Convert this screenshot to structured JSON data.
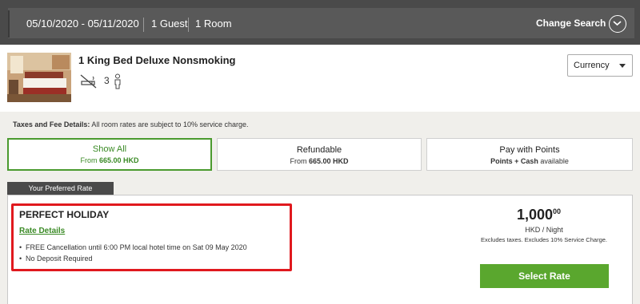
{
  "search": {
    "dates": "05/10/2020 - 05/11/2020",
    "guests": "1 Guest",
    "rooms": "1 Room",
    "change_label": "Change Search",
    "change_icon": "chevron-down-icon"
  },
  "room": {
    "title": "1 King Bed Deluxe Nonsmoking",
    "guest_count": "3",
    "icons": [
      "no-smoking-icon",
      "person-icon"
    ]
  },
  "currency": {
    "label": "Currency"
  },
  "tax": {
    "heading": "Taxes and Fee Details:",
    "text": "All room rates are subject to 10% service charge."
  },
  "filters": [
    {
      "title": "Show All",
      "sub_prefix": "From ",
      "sub_value": "665.00 HKD",
      "active": true
    },
    {
      "title": "Refundable",
      "sub_prefix": "From ",
      "sub_value": "665.00 HKD",
      "active": false
    },
    {
      "title": "Pay with Points",
      "sub_prefix": "",
      "sub_value": "Points + Cash",
      "sub_suffix": " available",
      "active": false
    }
  ],
  "rate": {
    "tab_label": "Your Preferred Rate",
    "plan_name": "PERFECT HOLIDAY",
    "details_link": "Rate Details",
    "bullets": [
      "FREE Cancellation until 6:00 PM local hotel time on Sat 09 May 2020",
      "No Deposit Required"
    ],
    "price_main": "1,000",
    "price_cents": "00",
    "per_night": "HKD / Night",
    "excludes": "Excludes taxes. Excludes 10% Service Charge.",
    "select_label": "Select Rate"
  },
  "colors": {
    "accent_green": "#5aa72e",
    "highlight_red": "#e0191e",
    "bar_dark": "#4a4a4a"
  }
}
